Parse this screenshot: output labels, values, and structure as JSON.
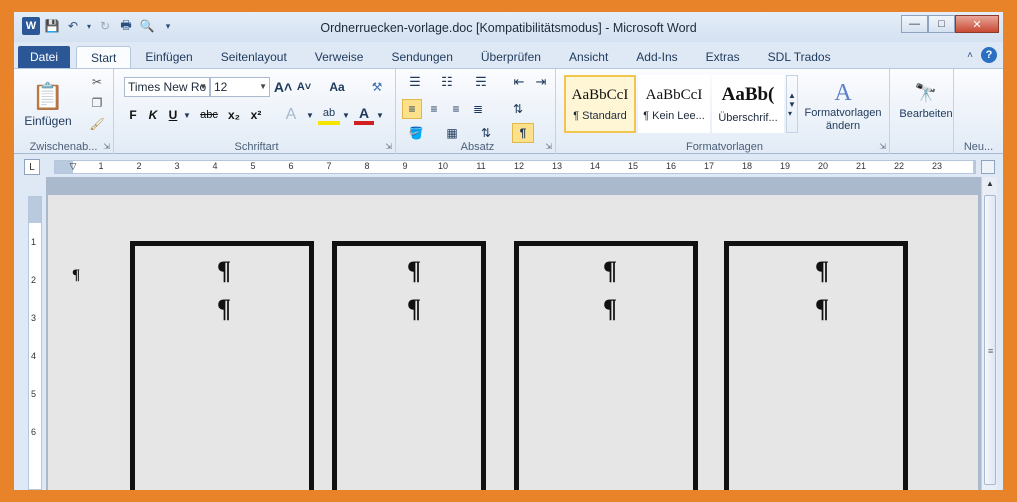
{
  "window": {
    "title": "Ordnerruecken-vorlage.doc [Kompatibilitätsmodus]  -  Microsoft Word",
    "app_icon": "W",
    "controls": {
      "minimize": "—",
      "maximize": "□",
      "close": "✕"
    }
  },
  "qat": {
    "save_icon": "save-icon",
    "undo_icon": "undo-icon",
    "redo_icon": "redo-icon",
    "print_icon": "print-icon",
    "preview_icon": "print-preview-icon",
    "customize_icon": "chevron-down-icon"
  },
  "tabs": [
    {
      "label": "Datei",
      "kind": "file"
    },
    {
      "label": "Start",
      "kind": "active"
    },
    {
      "label": "Einfügen"
    },
    {
      "label": "Seitenlayout"
    },
    {
      "label": "Verweise"
    },
    {
      "label": "Sendungen"
    },
    {
      "label": "Überprüfen"
    },
    {
      "label": "Ansicht"
    },
    {
      "label": "Add-Ins"
    },
    {
      "label": "Extras"
    },
    {
      "label": "SDL Trados"
    }
  ],
  "help": "?",
  "ribbon": {
    "clipboard": {
      "label": "Zwischenab...",
      "paste": "Einfügen"
    },
    "font": {
      "label": "Schriftart",
      "font_name": "Times New Ro",
      "font_size": "12",
      "bold": "F",
      "italic": "K",
      "underline": "U",
      "strike": "abc",
      "subscript": "x₂",
      "superscript": "x²",
      "grow": "A˄",
      "shrink": "A˅",
      "case": "Aa",
      "highlight": "ab",
      "color": "A"
    },
    "paragraph": {
      "label": "Absatz",
      "show_marks": "¶"
    },
    "styles": {
      "label": "Formatvorlagen",
      "items": [
        {
          "sample": "AaBbCcI",
          "name": "¶ Standard"
        },
        {
          "sample": "AaBbCcI",
          "name": "¶ Kein Lee..."
        },
        {
          "sample": "AaBb(",
          "name": "Überschrif..."
        }
      ],
      "change": "Formatvorlagen ändern"
    },
    "editing": {
      "label": "Neu...",
      "button": "Bearbeiten"
    }
  },
  "ruler": {
    "numbers": [
      "1",
      "1",
      "2",
      "3",
      "4",
      "5",
      "6",
      "7",
      "8",
      "9",
      "10",
      "11",
      "12",
      "13",
      "14",
      "15",
      "16",
      "17",
      "18",
      "19",
      "20",
      "21",
      "22",
      "23"
    ],
    "v_numbers": [
      "1",
      "2",
      "3",
      "4",
      "5",
      "6"
    ],
    "tab_selector": "L"
  },
  "document": {
    "para_mark": "¶",
    "spines": 4
  }
}
